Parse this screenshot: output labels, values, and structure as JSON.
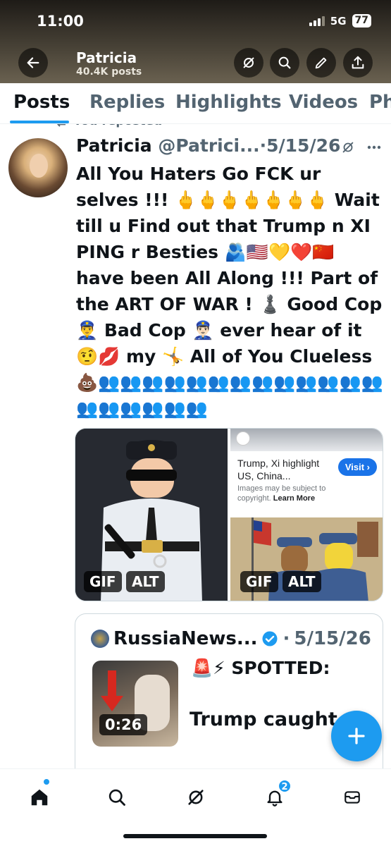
{
  "status_bar": {
    "time": "11:00",
    "network": "5G",
    "battery": "77"
  },
  "header": {
    "profile_name": "Patricia",
    "posts_count": "40.4K posts"
  },
  "tabs": [
    "Posts",
    "Replies",
    "Highlights",
    "Videos",
    "Ph"
  ],
  "repost_label": "You reposted",
  "tweet": {
    "author": "Patricia",
    "handle": "@Patrici...",
    "separator": "·",
    "date": "5/15/26",
    "body": "All You Haters Go FCK ur selves !!! 🖕🖕🖕🖕🖕🖕🖕 Wait till u Find out that Trump n XI PING r Besties 🫂🇺🇸💛❤️🇨🇳 have been All Along !!! Part of the ART OF WAR ! ♟️ Good Cop 👮‍♂️ Bad Cop 👮🏻‍♂️ ever hear of it 🤨💋 my 🤸 All of You Clueless 💩👥👥👥👥👥👥👥👥👥👥👥👥👥👥👥👥👥👥👥"
  },
  "media": {
    "gif_badge": "GIF",
    "alt_badge": "ALT",
    "search_card_title": "Trump, Xi highlight US, China...",
    "search_card_note": "Images may be subject to copyright.",
    "search_card_learn": "Learn More",
    "visit_label": "Visit ›"
  },
  "quote": {
    "author": "RussiaNews...",
    "separator": "·",
    "date": "5/15/26",
    "line1": "🚨⚡ SPOTTED:",
    "line2": "Trump caught s",
    "video_duration": "0:26"
  },
  "bottom_nav": {
    "notification_count": "2"
  },
  "colors": {
    "accent": "#1d9bf0",
    "text": "#0f1419",
    "muted": "#536471"
  }
}
